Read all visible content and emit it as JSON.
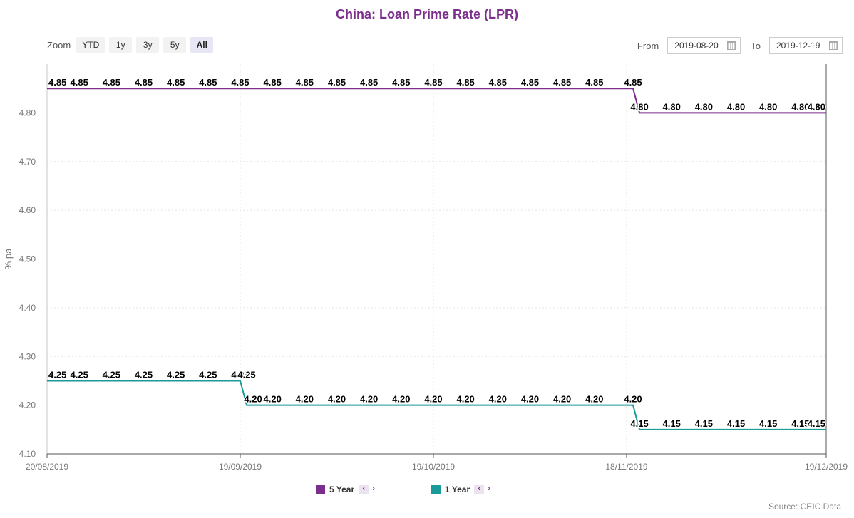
{
  "title": "China: Loan Prime Rate (LPR)",
  "toolbar": {
    "zoom_label": "Zoom",
    "zoom_buttons": [
      "YTD",
      "1y",
      "3y",
      "5y",
      "All"
    ],
    "active_zoom": "All",
    "from_label": "From",
    "from_value": "2019-08-20",
    "to_label": "To",
    "to_value": "2019-12-19"
  },
  "source": "Source: CEIC Data",
  "colors": {
    "five_year": "#7b2e8c",
    "one_year": "#1a9a9a",
    "title": "#7b2e8c"
  },
  "chart_data": {
    "type": "line",
    "title": "China: Loan Prime Rate (LPR)",
    "xlabel": "",
    "ylabel": "% pa",
    "x_range": [
      "2019-08-20",
      "2019-12-19"
    ],
    "x_ticks": [
      {
        "date": "2019-08-20",
        "label": "20/08/2019"
      },
      {
        "date": "2019-09-19",
        "label": "19/09/2019"
      },
      {
        "date": "2019-10-19",
        "label": "19/10/2019"
      },
      {
        "date": "2019-11-18",
        "label": "18/11/2019"
      },
      {
        "date": "2019-12-19",
        "label": "19/12/2019"
      }
    ],
    "y_ticks": [
      "4.10",
      "4.20",
      "4.30",
      "4.40",
      "4.50",
      "4.60",
      "4.70",
      "4.80"
    ],
    "ylim": [
      4.1,
      4.9
    ],
    "grid": true,
    "legend_position": "bottom",
    "series": [
      {
        "name": "5 Year",
        "color": "#7b2e8c",
        "steps": [
          {
            "date": "2019-08-20",
            "value": 4.85
          },
          {
            "date": "2019-11-20",
            "value": 4.8
          }
        ],
        "labels": [
          {
            "date": "2019-08-20",
            "text": "4.85"
          },
          {
            "date": "2019-08-25",
            "text": "4.85"
          },
          {
            "date": "2019-08-30",
            "text": "4.85"
          },
          {
            "date": "2019-09-04",
            "text": "4.85"
          },
          {
            "date": "2019-09-09",
            "text": "4.85"
          },
          {
            "date": "2019-09-14",
            "text": "4.85"
          },
          {
            "date": "2019-09-19",
            "text": "4.85"
          },
          {
            "date": "2019-09-24",
            "text": "4.85"
          },
          {
            "date": "2019-09-29",
            "text": "4.85"
          },
          {
            "date": "2019-10-04",
            "text": "4.85"
          },
          {
            "date": "2019-10-09",
            "text": "4.85"
          },
          {
            "date": "2019-10-14",
            "text": "4.85"
          },
          {
            "date": "2019-10-19",
            "text": "4.85"
          },
          {
            "date": "2019-10-24",
            "text": "4.85"
          },
          {
            "date": "2019-10-29",
            "text": "4.85"
          },
          {
            "date": "2019-11-03",
            "text": "4.85"
          },
          {
            "date": "2019-11-08",
            "text": "4.85"
          },
          {
            "date": "2019-11-13",
            "text": "4.85"
          },
          {
            "date": "2019-11-19",
            "text": "4.85"
          },
          {
            "date": "2019-11-20",
            "text": "4.80"
          },
          {
            "date": "2019-11-25",
            "text": "4.80"
          },
          {
            "date": "2019-11-30",
            "text": "4.80"
          },
          {
            "date": "2019-12-05",
            "text": "4.80"
          },
          {
            "date": "2019-12-10",
            "text": "4.80"
          },
          {
            "date": "2019-12-15",
            "text": "4.80"
          },
          {
            "date": "2019-12-19",
            "text": "4.80"
          }
        ]
      },
      {
        "name": "1 Year",
        "color": "#1a9a9a",
        "steps": [
          {
            "date": "2019-08-20",
            "value": 4.25
          },
          {
            "date": "2019-09-20",
            "value": 4.2
          },
          {
            "date": "2019-11-20",
            "value": 4.15
          }
        ],
        "labels": [
          {
            "date": "2019-08-20",
            "text": "4.25"
          },
          {
            "date": "2019-08-25",
            "text": "4.25"
          },
          {
            "date": "2019-08-30",
            "text": "4.25"
          },
          {
            "date": "2019-09-04",
            "text": "4.25"
          },
          {
            "date": "2019-09-09",
            "text": "4.25"
          },
          {
            "date": "2019-09-14",
            "text": "4.25"
          },
          {
            "date": "2019-09-19",
            "text": "4.25"
          },
          {
            "date": "2019-09-20",
            "text": "4.25"
          },
          {
            "date": "2019-09-21",
            "text": "4.20"
          },
          {
            "date": "2019-09-24",
            "text": "4.20"
          },
          {
            "date": "2019-09-29",
            "text": "4.20"
          },
          {
            "date": "2019-10-04",
            "text": "4.20"
          },
          {
            "date": "2019-10-09",
            "text": "4.20"
          },
          {
            "date": "2019-10-14",
            "text": "4.20"
          },
          {
            "date": "2019-10-19",
            "text": "4.20"
          },
          {
            "date": "2019-10-24",
            "text": "4.20"
          },
          {
            "date": "2019-10-29",
            "text": "4.20"
          },
          {
            "date": "2019-11-03",
            "text": "4.20"
          },
          {
            "date": "2019-11-08",
            "text": "4.20"
          },
          {
            "date": "2019-11-13",
            "text": "4.20"
          },
          {
            "date": "2019-11-19",
            "text": "4.20"
          },
          {
            "date": "2019-11-20",
            "text": "4.15"
          },
          {
            "date": "2019-11-25",
            "text": "4.15"
          },
          {
            "date": "2019-11-30",
            "text": "4.15"
          },
          {
            "date": "2019-12-05",
            "text": "4.15"
          },
          {
            "date": "2019-12-10",
            "text": "4.15"
          },
          {
            "date": "2019-12-15",
            "text": "4.15"
          },
          {
            "date": "2019-12-19",
            "text": "4.15"
          }
        ]
      }
    ]
  }
}
